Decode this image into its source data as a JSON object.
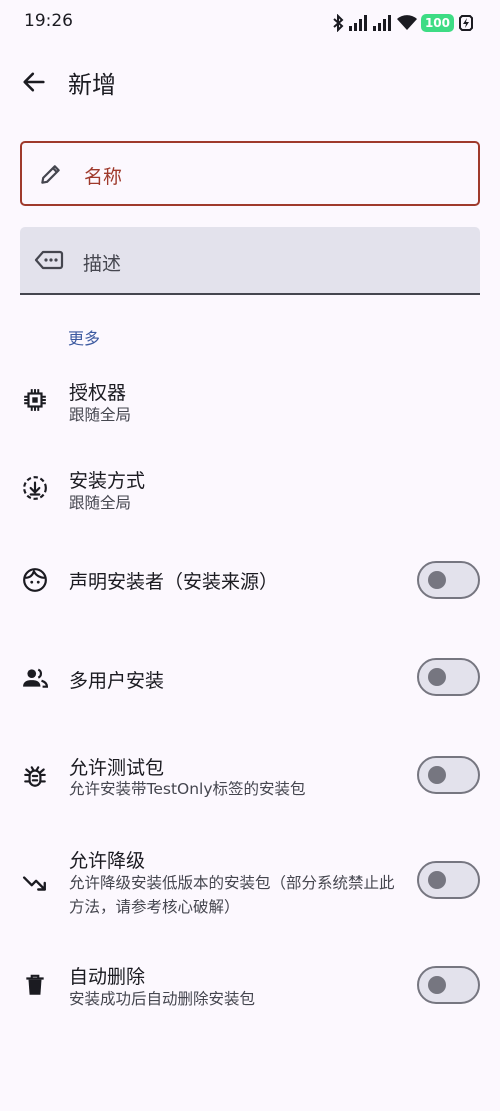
{
  "status": {
    "time": "19:26",
    "battery": "100"
  },
  "appbar": {
    "title": "新增"
  },
  "form": {
    "name_placeholder": "名称",
    "desc_placeholder": "描述"
  },
  "section_more": "更多",
  "settings": [
    {
      "title": "授权器",
      "subtitle": "跟随全局",
      "icon": "chip-icon"
    },
    {
      "title": "安装方式",
      "subtitle": "跟随全局",
      "icon": "install-download-icon"
    },
    {
      "title": "声明安装者（安装来源）",
      "icon": "face-icon",
      "toggle": false
    },
    {
      "title": "多用户安装",
      "icon": "people-icon",
      "toggle": false
    },
    {
      "title": "允许测试包",
      "subtitle": "允许安装带TestOnly标签的安装包",
      "icon": "bug-icon",
      "toggle": false
    },
    {
      "title": "允许降级",
      "subtitle": "允许降级安装低版本的安装包（部分系统禁止此方法，请参考核心破解）",
      "icon": "trending-down-icon",
      "toggle": false
    },
    {
      "title": "自动删除",
      "subtitle": "安装成功后自动删除安装包",
      "icon": "trash-icon",
      "toggle": false
    }
  ],
  "colors": {
    "background": "#fcf8fe",
    "error": "#9f3a2c",
    "accent": "#3d5aa0"
  }
}
